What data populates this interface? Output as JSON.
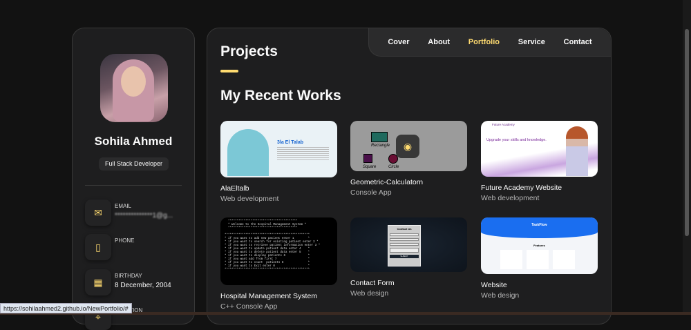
{
  "profile": {
    "name": "Sohila Ahmed",
    "title": "Full Stack Developer",
    "contacts": [
      {
        "icon": "mail-icon",
        "label": "EMAIL",
        "value": "**************1@g..."
      },
      {
        "icon": "phone-icon",
        "label": "PHONE",
        "value": ""
      },
      {
        "icon": "calendar-icon",
        "label": "BIRTHDAY",
        "value": "8 December, 2004"
      },
      {
        "icon": "location-icon",
        "label": "LOCATION",
        "value": ""
      }
    ]
  },
  "nav": {
    "items": [
      "Cover",
      "About",
      "Portfolio",
      "Service",
      "Contact"
    ],
    "active": "Portfolio"
  },
  "section": {
    "title": "Projects",
    "subtitle": "My Recent Works"
  },
  "projects": [
    {
      "title": "AlaEltalb",
      "category": "Web development"
    },
    {
      "title": "Geometric-Calculatorn",
      "category": "Console App"
    },
    {
      "title": "Future Academy Website",
      "category": "Web development"
    },
    {
      "title": "Hospital Management System",
      "category": "C++ Console App"
    },
    {
      "title": "Contact Form",
      "category": "Web design"
    },
    {
      "title": "Website",
      "category": "Web design"
    }
  ],
  "thumbs": {
    "alaeltalb_heading": "3la El Talab",
    "geo_labels": [
      "Rectangle",
      "Square",
      "Circle"
    ],
    "future_heading": "Future Academy",
    "future_tagline": "Upgrade your skills and knowledge.",
    "terminal": "  ****************************************\n  * Welcome to the Hospital Management System *\n  ****************************************\n\n*************************************************\n* if you want to add new patient enter 1        *\n* if you want to search for existing patient enter 2 *\n* if you want to retrieve patient information enter 3 *\n* if you want to update patient data enter 4    *\n* if you want to delete patient data enter 5    *\n* if you want to display patients 6             *\n* if you want add from first 7                  *\n* if you want to count  patients 8              *\n* if you want to Exit enter 0                   *\n*************************************************",
    "contact_heading": "Contact Us",
    "contact_submit": "SUBMIT",
    "taskflow_title": "TaskFlow",
    "taskflow_features": "Features"
  },
  "statusbar": {
    "url": "https://sohilaahmed2.github.io/NewPortfolio/#"
  },
  "colors": {
    "accent": "#ffdb70",
    "bg": "#121212",
    "panel": "#1e1e1f"
  }
}
